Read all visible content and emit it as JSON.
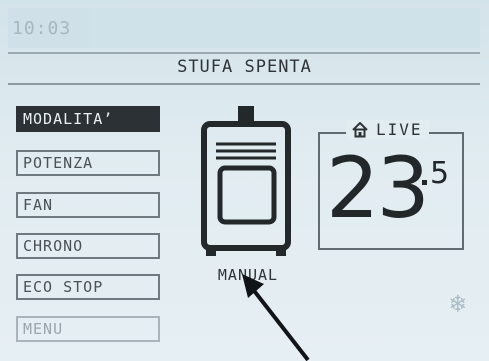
{
  "header": {
    "time": "10:03"
  },
  "status": {
    "text": "STUFA SPENTA"
  },
  "menu": {
    "items": [
      {
        "label": "MODALITA’",
        "state": "active"
      },
      {
        "label": "POTENZA",
        "state": "normal"
      },
      {
        "label": "FAN",
        "state": "normal"
      },
      {
        "label": "CHRONO",
        "state": "normal"
      },
      {
        "label": "ECO STOP",
        "state": "normal"
      },
      {
        "label": "MENU",
        "state": "dim"
      }
    ]
  },
  "stove": {
    "mode": "MANUAL"
  },
  "temperature": {
    "label": "LIVE",
    "integer": "23",
    "decimal": "5"
  },
  "icons": {
    "home": "home-icon",
    "snow": "snowflake-icon"
  }
}
